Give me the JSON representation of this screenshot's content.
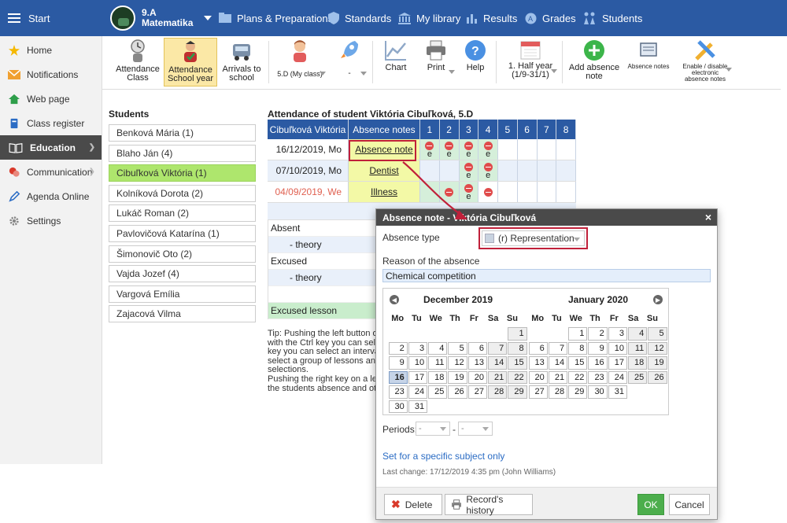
{
  "topbar": {
    "start": "Start",
    "class_name": "9.A",
    "class_subject": "Matematika",
    "nav": [
      {
        "label": "Plans & Preparations",
        "icon": "folder-icon"
      },
      {
        "label": "Standards",
        "icon": "shield-icon"
      },
      {
        "label": "My library",
        "icon": "library-icon"
      },
      {
        "label": "Results",
        "icon": "bar-chart-icon"
      },
      {
        "label": "Grades",
        "icon": "grades-icon"
      },
      {
        "label": "Students",
        "icon": "students-icon"
      }
    ]
  },
  "sidebar": {
    "items": [
      {
        "label": "Home",
        "icon": "star-icon"
      },
      {
        "label": "Notifications",
        "icon": "envelope-icon"
      },
      {
        "label": "Web page",
        "icon": "house-icon"
      },
      {
        "label": "Class register",
        "icon": "book-icon"
      },
      {
        "label": "Education",
        "icon": "open-book-icon"
      },
      {
        "label": "Communication",
        "icon": "chat-icon"
      },
      {
        "label": "Agenda Online",
        "icon": "pen-icon"
      },
      {
        "label": "Settings",
        "icon": "gear-icon"
      }
    ]
  },
  "toolbar": {
    "attendance_class_1": "Attendance",
    "attendance_class_2": "Class",
    "attendance_year_1": "Attendance",
    "attendance_year_2": "School year",
    "arrivals_1": "Arrivals to",
    "arrivals_2": "school",
    "myclass": "5.D (My class)",
    "dash": "-",
    "chart": "Chart",
    "print": "Print",
    "help": "Help",
    "half_year_1": "1. Half year",
    "half_year_2": "(1/9-31/1)",
    "add_note_1": "Add absence",
    "add_note_2": "note",
    "absence_notes": "Absence notes",
    "enable_1": "Enable / disable",
    "enable_2": "electronic",
    "enable_3": "absence notes"
  },
  "students": {
    "title": "Students",
    "list": [
      "Benková Mária (1)",
      "Blaho Ján (4)",
      "Cibuľková Viktória (1)",
      "Kolníková Dorota (2)",
      "Lukáč Roman (2)",
      "Pavlovičová Katarína (1)",
      "Šimonovič Oto (2)",
      "Vajda Jozef (4)",
      "Vargová Emília",
      "Zajacová Vilma"
    ]
  },
  "attendance": {
    "title": "Attendance of student Viktória Cibuľková, 5.D",
    "col_name": "Cibuľková Viktória",
    "col_notes": "Absence notes",
    "lessons": [
      "1",
      "2",
      "3",
      "4",
      "5",
      "6",
      "7",
      "8"
    ],
    "rows": [
      {
        "date": "16/12/2019, Mo",
        "note": "Absence note"
      },
      {
        "date": "07/10/2019, Mo",
        "note": "Dentist"
      },
      {
        "date": "04/09/2019, We",
        "note": "Illness"
      }
    ],
    "e_mark": "e",
    "absent": "Absent",
    "theory": "- theory",
    "excused": "Excused",
    "excused_lesson": "Excused lesson"
  },
  "tip": {
    "lines": [
      "Tip: Pushing the left button or",
      "with the Ctrl key you can selec",
      "key you can select an interval",
      "select a group of lessons and",
      "selections.",
      "Pushing the right key on a les",
      "the students absence and oth"
    ]
  },
  "dialog": {
    "title": "Absence note - Viktória Cibuľková",
    "close": "×",
    "absence_type_label": "Absence type",
    "absence_type_value": "(r) Representation",
    "reason_label": "Reason of the absence",
    "reason_value": "Chemical competition",
    "prev": "◀",
    "next": "▶",
    "dec_title": "December 2019",
    "jan_title": "January 2020",
    "dow": [
      "Mo",
      "Tu",
      "We",
      "Th",
      "Fr",
      "Sa",
      "Su"
    ],
    "periods_label": "Periods:",
    "period_from": "-",
    "period_to": "-",
    "period_dash": "-",
    "specific_link": "Set for a specific subject only",
    "last_change": "Last change: 17/12/2019 4:35 pm (John Williams)",
    "delete": "Delete",
    "history": "Record's history",
    "ok": "OK",
    "cancel": "Cancel"
  }
}
